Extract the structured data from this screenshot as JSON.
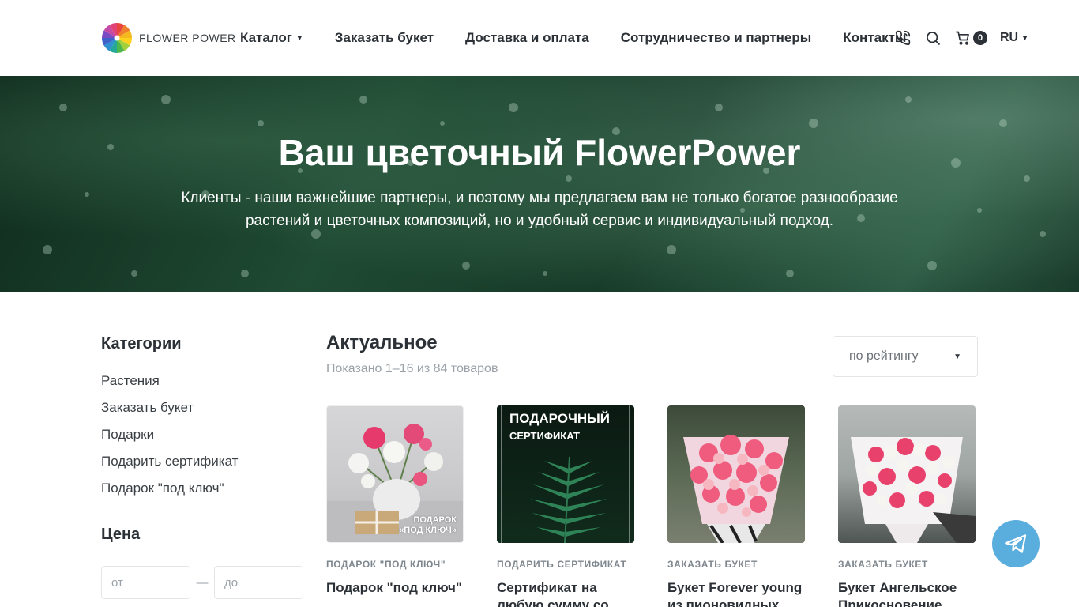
{
  "header": {
    "logo_text": "FLOWER POWER",
    "nav": [
      {
        "label": "Каталог",
        "has_dropdown": true
      },
      {
        "label": "Заказать букет",
        "has_dropdown": false
      },
      {
        "label": "Доставка и оплата",
        "has_dropdown": false
      },
      {
        "label": "Сотрудничество и партнеры",
        "has_dropdown": false
      },
      {
        "label": "Контакты",
        "has_dropdown": false
      }
    ],
    "cart_count": "0",
    "language": "RU",
    "icons": [
      "phone-icon",
      "search-icon",
      "cart-icon",
      "chevron-down-icon"
    ]
  },
  "hero": {
    "title": "Ваш цветочный FlowerPower",
    "subtitle": "Клиенты - наши важнейшие партнеры, и поэтому мы предлагаем вам не только богатое разнообразие растений и цветочных композиций, но и удобный сервис и индивидуальный подход."
  },
  "sidebar": {
    "categories_title": "Категории",
    "categories": [
      "Растения",
      "Заказать букет",
      "Подарки",
      "Подарить сертификат",
      "Подарок \"под ключ\""
    ],
    "price_title": "Цена",
    "price_from_placeholder": "от",
    "price_to_placeholder": "до",
    "price_dash": "—"
  },
  "main": {
    "title": "Актуальное",
    "count_text": "Показано 1–16 из 84 товаров",
    "sort_label": "по рейтингу",
    "products": [
      {
        "category": "ПОДАРОК \"ПОД КЛЮЧ\"",
        "name": "Подарок \"под ключ\"",
        "image_caption_1": "ПОДАРОК",
        "image_caption_2": "«ПОД КЛЮЧ»"
      },
      {
        "category": "ПОДАРИТЬ СЕРТИФИКАТ",
        "name": "Сертификат на любую сумму со",
        "image_caption_1": "ПОДАРОЧНЫЙ",
        "image_caption_2": "СЕРТИФИКАТ"
      },
      {
        "category": "ЗАКАЗАТЬ БУКЕТ",
        "name": "Букет Forever young из пионовидных"
      },
      {
        "category": "ЗАКАЗАТЬ БУКЕТ",
        "name": "Букет Ангельское Прикосновение"
      }
    ]
  },
  "colors": {
    "text_dark": "#2b3136",
    "muted": "#9aa1a8",
    "telegram": "#5aaedd"
  }
}
